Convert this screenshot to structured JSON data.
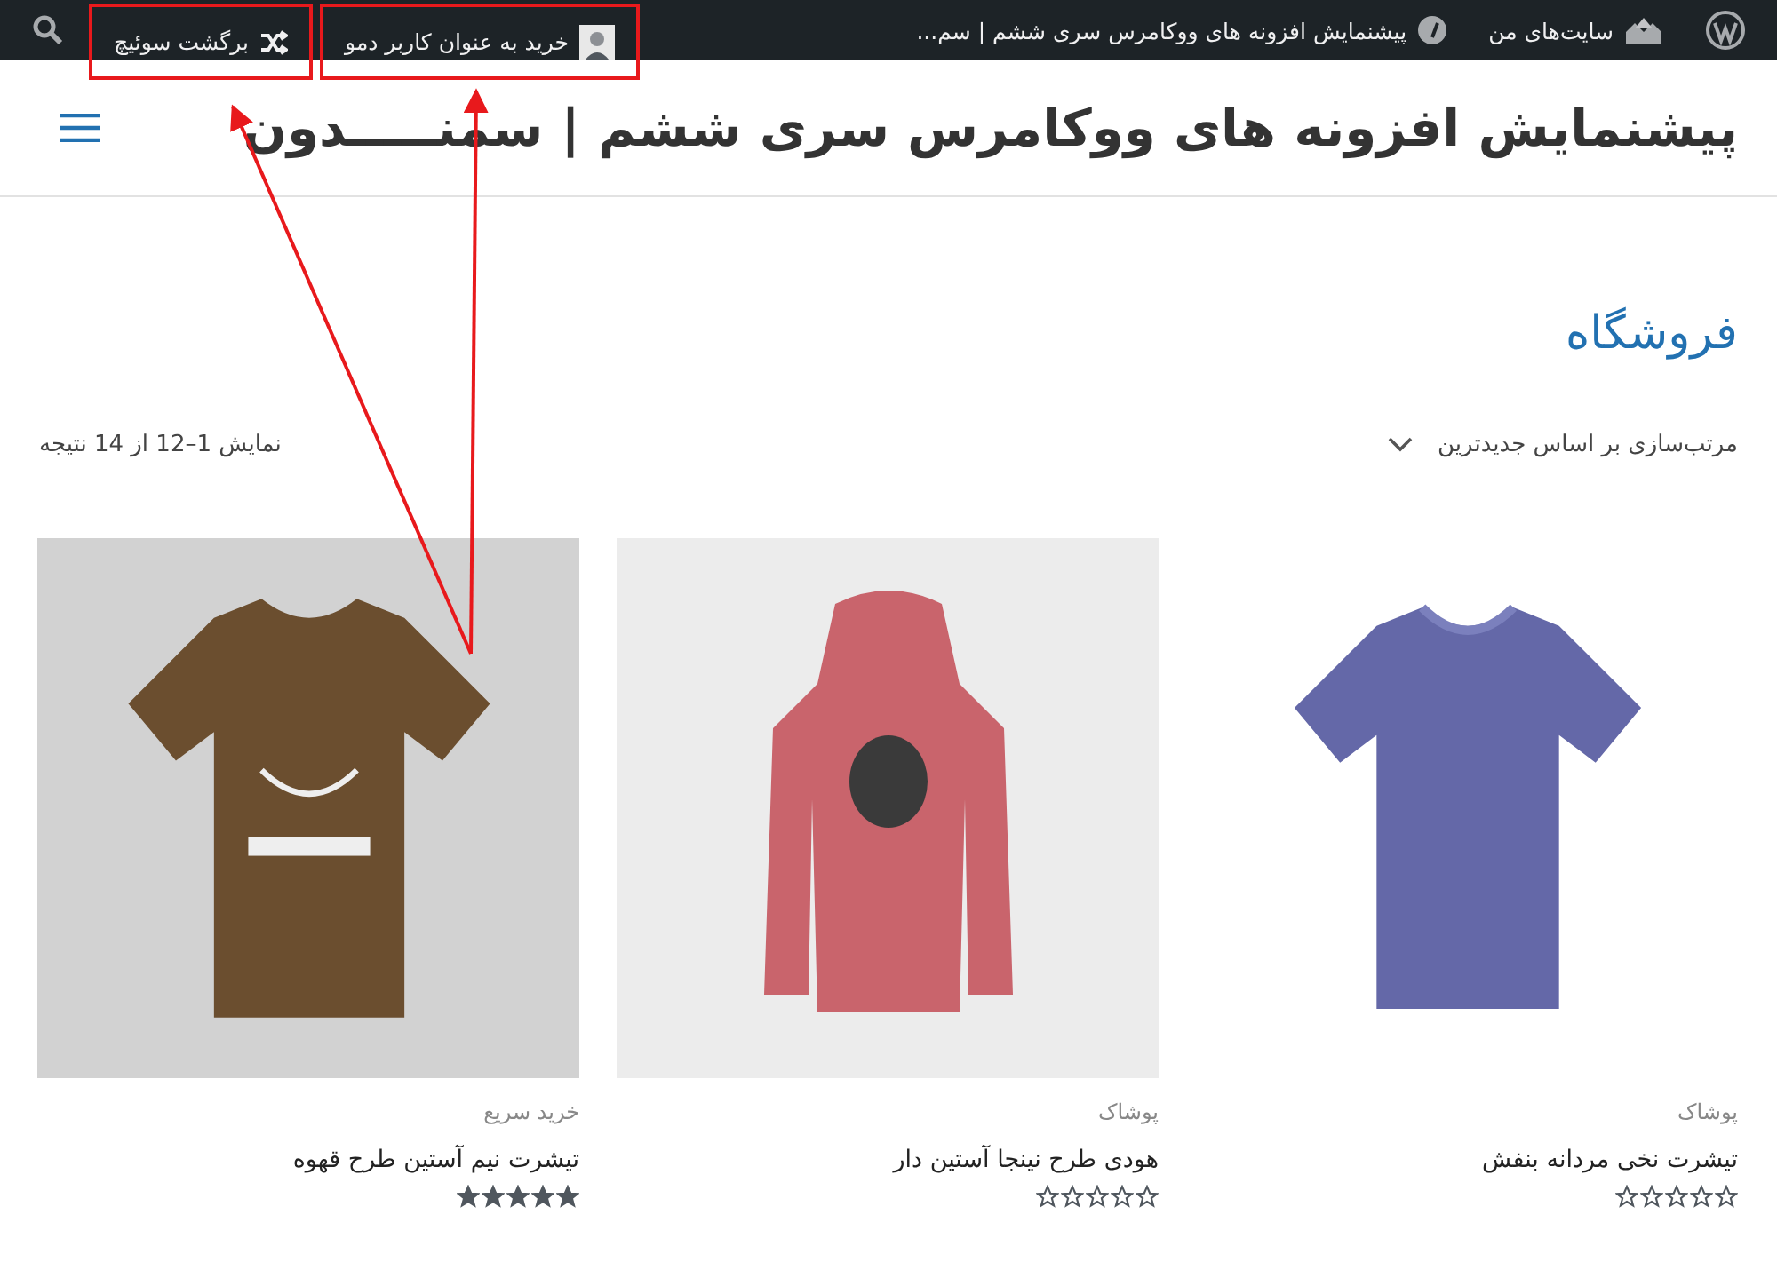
{
  "admin_bar": {
    "items": [
      {
        "kind": "logo",
        "highlighted": false
      },
      {
        "kind": "sites",
        "label": "سایت‌های من",
        "highlighted": false
      },
      {
        "kind": "site",
        "label": "پیشنمایش افزونه های ووکامرس سری ششم | سم...",
        "highlighted": false
      },
      {
        "kind": "user",
        "label": "خرید به عنوان کاربر دمو",
        "highlighted": true
      },
      {
        "kind": "switch",
        "label": "برگشت سوئیچ",
        "highlighted": true
      },
      {
        "kind": "search",
        "highlighted": false
      }
    ]
  },
  "header": {
    "site_title": "پیشنمایش افزونه های ووکامرس سری ششم | سمنـــــدون"
  },
  "shop": {
    "title": "فروشگاه",
    "sort": "مرتب‌سازی بر اساس جدیدترین",
    "result_count": "نمایش 1–12 از 14 نتیجه",
    "products": [
      {
        "category": "پوشاک",
        "name": "تیشرت نخی مردانه بنفش",
        "stars": 0,
        "kind": "plain-tee"
      },
      {
        "category": "پوشاک",
        "name": "هودی طرح نینجا آستین دار",
        "stars": 0,
        "kind": "hoodie"
      },
      {
        "category": "خرید سریع",
        "name": "تیشرت نیم آستین طرح قهوه",
        "stars": 5,
        "kind": "print-tee"
      }
    ]
  }
}
